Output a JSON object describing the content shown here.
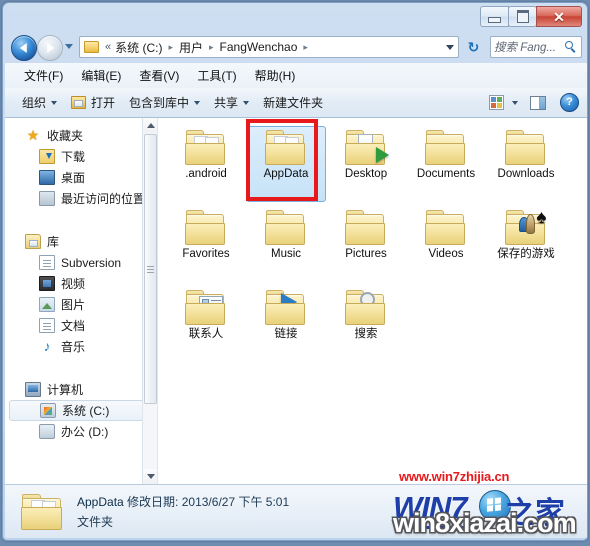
{
  "window": {
    "buttons": {
      "minimize": "minimize-button",
      "maximize": "maximize-button",
      "close_glyph": "✕"
    }
  },
  "nav": {
    "back_title": "后退",
    "forward_title": "前进",
    "history_title": "最近浏览的位置",
    "refresh_glyph": "↻",
    "breadcrumb": {
      "overflow": "«",
      "items": [
        "系统 (C:)",
        "用户",
        "FangWenchao"
      ],
      "separator": "▸"
    },
    "search": {
      "placeholder": "搜索 Fang...",
      "icon": "search-icon"
    }
  },
  "menubar": {
    "items": [
      "文件(F)",
      "编辑(E)",
      "查看(V)",
      "工具(T)",
      "帮助(H)"
    ]
  },
  "toolbar": {
    "organize": "组织",
    "open": "打开",
    "include_in_library": "包含到库中",
    "share": "共享",
    "new_folder": "新建文件夹",
    "view_icon": "view-icon",
    "preview_pane_icon": "preview-pane-icon",
    "help_glyph": "?"
  },
  "sidebar": {
    "groups": [
      {
        "header": {
          "label": "收藏夹",
          "icon": "star-icon"
        },
        "items": [
          {
            "label": "下载",
            "icon": "downloads-icon"
          },
          {
            "label": "桌面",
            "icon": "desktop-icon"
          },
          {
            "label": "最近访问的位置",
            "icon": "recent-places-icon"
          }
        ]
      },
      {
        "header": {
          "label": "库",
          "icon": "library-icon"
        },
        "items": [
          {
            "label": "Subversion",
            "icon": "document-icon"
          },
          {
            "label": "视频",
            "icon": "video-icon"
          },
          {
            "label": "图片",
            "icon": "picture-icon"
          },
          {
            "label": "文档",
            "icon": "document-icon"
          },
          {
            "label": "音乐",
            "icon": "music-icon"
          }
        ]
      },
      {
        "header": {
          "label": "计算机",
          "icon": "computer-icon"
        },
        "items": [
          {
            "label": "系统 (C:)",
            "icon": "windows-drive-icon",
            "selected": true
          },
          {
            "label": "办公 (D:)",
            "icon": "drive-icon"
          }
        ]
      }
    ]
  },
  "files": {
    "items": [
      {
        "label": ".android",
        "emblem": "none",
        "selected": false
      },
      {
        "label": "AppData",
        "emblem": "none",
        "selected": true
      },
      {
        "label": "Desktop",
        "emblem": "desktop",
        "selected": false
      },
      {
        "label": "Documents",
        "emblem": "none",
        "selected": false
      },
      {
        "label": "Downloads",
        "emblem": "none",
        "selected": false
      },
      {
        "label": "Favorites",
        "emblem": "none",
        "selected": false
      },
      {
        "label": "Music",
        "emblem": "none",
        "selected": false
      },
      {
        "label": "Pictures",
        "emblem": "none",
        "selected": false
      },
      {
        "label": "Videos",
        "emblem": "none",
        "selected": false
      },
      {
        "label": "保存的游戏",
        "emblem": "game",
        "selected": false
      },
      {
        "label": "联系人",
        "emblem": "contact",
        "selected": false
      },
      {
        "label": "链接",
        "emblem": "link",
        "selected": false
      },
      {
        "label": "搜索",
        "emblem": "search",
        "selected": false
      }
    ]
  },
  "status": {
    "name": "AppData",
    "modified_label": "修改日期:",
    "modified_value": "2013/6/27 下午 5:01",
    "type": "文件夹"
  },
  "watermarks": {
    "red_url": "www.win7zhijia.cn",
    "logo_text": "WIN7",
    "logo_cjk": "之家",
    "outlined_url": "win8xiazai.com"
  },
  "colors": {
    "selection_highlight": "#e8191b",
    "accent_blue": "#1f3fa8",
    "title_bar": "#bdd2ec"
  }
}
